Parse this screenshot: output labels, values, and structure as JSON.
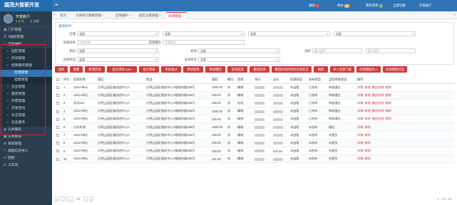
{
  "brand": {
    "title": "国茂大管家开发"
  },
  "user": {
    "name": "开发账户",
    "status": "● 在线",
    "logout": "⊘ 注销"
  },
  "sidebar": {
    "items": [
      {
        "label": "门户管理",
        "level": 0,
        "icon": "grid-icon",
        "arrow": "‹"
      },
      {
        "label": "T恤砂管理",
        "level": 0,
        "icon": "list-icon",
        "arrow": "‹"
      },
      {
        "label": "全园维护",
        "level": 0,
        "icon": "home-icon",
        "arrow": "⌄",
        "active": true
      },
      {
        "label": "园区管理",
        "level": 1,
        "icon": "doc-icon"
      },
      {
        "label": "房间管理",
        "level": 1,
        "icon": "doc-icon"
      },
      {
        "label": "招商服务管理",
        "level": 1,
        "icon": "doc-icon",
        "arrow": "⌄"
      },
      {
        "label": "房源管理",
        "level": 2,
        "icon": "dot-icon",
        "selected": true
      },
      {
        "label": "挂租管理",
        "level": 2,
        "icon": "dot-icon"
      },
      {
        "label": "企业管理",
        "level": 1,
        "icon": "doc-icon"
      },
      {
        "label": "租赁管理",
        "level": 1,
        "icon": "doc-icon"
      },
      {
        "label": "开票管理",
        "level": 1,
        "icon": "doc-icon"
      },
      {
        "label": "开发空间",
        "level": 1,
        "icon": "doc-icon"
      },
      {
        "label": "日志管理",
        "level": 1,
        "icon": "doc-icon"
      },
      {
        "label": "信息服务",
        "level": 1,
        "icon": "doc-icon"
      },
      {
        "label": "公共服务",
        "level": 0,
        "icon": "globe-icon",
        "arrow": "‹"
      },
      {
        "label": "公共模块",
        "level": 0,
        "icon": "box-icon",
        "arrow": "‹"
      },
      {
        "label": "系统管理",
        "level": 0,
        "icon": "gear-icon",
        "arrow": "‹"
      },
      {
        "label": "基础信息导入",
        "level": 0,
        "icon": "upload-icon",
        "arrow": "‹"
      },
      {
        "label": "回顾",
        "level": 0,
        "icon": "history-icon"
      },
      {
        "label": "工作流",
        "level": 0,
        "icon": "flow-icon",
        "arrow": "‹"
      }
    ]
  },
  "topbar": {
    "items": [
      {
        "label": "通知",
        "badge": "2",
        "color": "red"
      },
      {
        "label": "待办",
        "badge": "12",
        "color": "orange"
      },
      {
        "label": "我的消息",
        "badge": "0",
        "color": "green"
      },
      {
        "label": "全屏切换",
        "badge": ""
      },
      {
        "label": "开发账户",
        "badge": ""
      }
    ]
  },
  "tabs": [
    {
      "label": "首页",
      "closable": false
    },
    {
      "label": "大屏统计数据管理",
      "closable": true
    },
    {
      "label": "区域维护",
      "closable": true
    },
    {
      "label": "园区设置管理",
      "closable": true
    },
    {
      "label": "房源管理",
      "closable": true,
      "active": true
    }
  ],
  "filter": {
    "title": "查询条件",
    "fields": [
      {
        "label": "区域",
        "value": "全部"
      },
      {
        "label": "",
        "value": "全部"
      },
      {
        "label": "",
        "value": "全部"
      },
      {
        "label": "",
        "value": "全部"
      },
      {
        "label": "房源名称",
        "value": "",
        "placeholder": "房源名称"
      },
      {
        "label": "房源楼号",
        "value": "",
        "placeholder": "房源楼号"
      },
      {
        "label": "朝向",
        "value": "全部"
      },
      {
        "label": "装修",
        "value": "全部"
      },
      {
        "label": "面积",
        "value": "",
        "placeholder": "最小面积"
      },
      {
        "label": "",
        "value": "",
        "placeholder": "最大面积"
      },
      {
        "label": "房源状态",
        "value": "全部"
      },
      {
        "label": "发布状态",
        "value": "全部"
      }
    ]
  },
  "toolbar": {
    "buttons": [
      "搜索",
      "重置",
      "新增房源",
      "提交审核-1pm",
      "提交审核",
      "审核通过",
      "审核拒绝",
      "审核撤回",
      "发布房源",
      "撤回房源",
      "撤回房源并修改房源状态",
      "删除",
      "导入房源下载",
      "房源模板导入",
      "房源模板导出"
    ]
  },
  "table": {
    "columns": [
      "",
      "序号",
      "房源名称",
      "园区",
      "地址",
      "面积",
      "朝向",
      "装修",
      "单价",
      "总价",
      "房源状态",
      "发布状态",
      "当前审核状态",
      "操作"
    ],
    "rows": [
      {
        "no": "1",
        "name": "1101A单元",
        "park": "贝壳山园区服务园中心A",
        "addr": "贝壳山园区服务中心A楼城东路168号",
        "area": "1800.00",
        "orient": "东",
        "deco": "精装",
        "price": "",
        "total": "",
        "status": "未出租",
        "pub": "已发布",
        "audit": "审核通过",
        "audit_cls": "st-green",
        "ops": [
          "详情",
          "修改",
          "撤回房源",
          "删除"
        ]
      },
      {
        "no": "2",
        "name": "1201A单元",
        "park": "贝壳山园区服务园中心A",
        "addr": "贝壳山园区服务中心A楼城东路168号",
        "area": "345.00",
        "orient": "东",
        "deco": "精装",
        "price": "",
        "total": "",
        "status": "未出租",
        "pub": "已发布",
        "audit": "审核通过",
        "audit_cls": "st-green",
        "ops": [
          "详情",
          "修改",
          "撤回房源",
          "删除"
        ]
      },
      {
        "no": "3",
        "name": "测试123",
        "park": "贝壳山园区服务园中心A",
        "addr": "贝壳山园区服务中心A楼城东路168号",
        "area": "345.00",
        "orient": "东",
        "deco": "毛坯",
        "price": "",
        "total": "",
        "status": "未出租",
        "pub": "已发布",
        "audit": "审核通过",
        "audit_cls": "st-green",
        "ops": [
          "详情",
          "修改",
          "撤回房源",
          "删除"
        ]
      },
      {
        "no": "4",
        "name": "1301A单元",
        "park": "贝壳山园区服务园中心A",
        "addr": "贝壳山园区服务中心A楼城东路168号",
        "area": "1800.00",
        "orient": "东",
        "deco": "精装",
        "price": "",
        "total": "",
        "status": "未出租",
        "pub": "已发布",
        "audit": "审核通过",
        "audit_cls": "st-green",
        "ops": [
          "详情",
          "修改",
          "撤回房源",
          "删除"
        ]
      },
      {
        "no": "5",
        "name": "1401A单元",
        "park": "贝壳山园区服务园中心A",
        "addr": "贝壳山园区服务中心A楼城东路168号",
        "area": "345.00",
        "orient": "东",
        "deco": "精装",
        "price": "",
        "total": "",
        "status": "未出租",
        "pub": "已发布",
        "audit": "审核通过",
        "audit_cls": "st-green",
        "ops": [
          "详情",
          "修改",
          "撤回房源",
          "删除"
        ]
      },
      {
        "no": "6",
        "name": "公共房源",
        "park": "贝壳山园区服务园中心A",
        "addr": "贝壳山园区服务中心A楼城东路168号",
        "area": "1800.00",
        "orient": "东",
        "deco": "精装",
        "price": "",
        "total": "",
        "status": "未出租",
        "pub": "未发布",
        "audit": "撤回",
        "audit_cls": "st-red",
        "ops": [
          "详情",
          "删除"
        ]
      },
      {
        "no": "7",
        "name": "1501A单元",
        "park": "贝壳山园区服务园中心A",
        "addr": "贝壳山园区服务中心A楼城东路168号",
        "area": "345.00",
        "orient": "东",
        "deco": "精装",
        "price": "",
        "total": "",
        "status": "未出租",
        "pub": "未发布",
        "audit": "未提交",
        "audit_cls": "st-orange",
        "ops": [
          "详情",
          "删除"
        ]
      },
      {
        "no": "8",
        "name": "1201A单元",
        "park": "贝壳山园区服务园中心A",
        "addr": "贝壳山园区服务中心A楼城东路168号",
        "area": "345.00",
        "orient": "东",
        "deco": "精装",
        "price": "",
        "total": "",
        "status": "未出租",
        "pub": "未发布",
        "audit": "未提交",
        "audit_cls": "st-orange",
        "ops": [
          "详情",
          "删除"
        ]
      },
      {
        "no": "9",
        "name": "1301A单元",
        "park": "贝壳山园区服务园中心A",
        "addr": "贝壳山园区服务中心A楼城东路168号",
        "area": "345.00",
        "orient": "东",
        "deco": "精装",
        "price": "",
        "total": "525.00",
        "status": "未出租",
        "pub": "未发布",
        "audit": "未提交",
        "audit_cls": "st-orange",
        "ops": [
          "详情",
          "删除"
        ]
      },
      {
        "no": "10",
        "name": "1401A单元",
        "park": "贝壳山园区服务园中心A",
        "addr": "贝壳山园区服务中心A楼城东路168号",
        "area": "321.00",
        "orient": "东",
        "deco": "精装",
        "price": "",
        "total": "",
        "status": "未出租",
        "pub": "未发布",
        "audit": "未提交",
        "audit_cls": "st-orange",
        "ops": [
          "详情",
          "删除"
        ]
      }
    ]
  },
  "pager": {
    "first": "«",
    "prev": "‹",
    "page": "1",
    "total_text": "/ 5",
    "next": "›",
    "last": "»",
    "right": "1 - 10 / 10"
  },
  "colors": {
    "brand": "#1f6fb0",
    "topbar": "#2f74b5",
    "sidebar": "#2b3e50",
    "button": "#d23b3b",
    "highlight": "#e02020"
  }
}
